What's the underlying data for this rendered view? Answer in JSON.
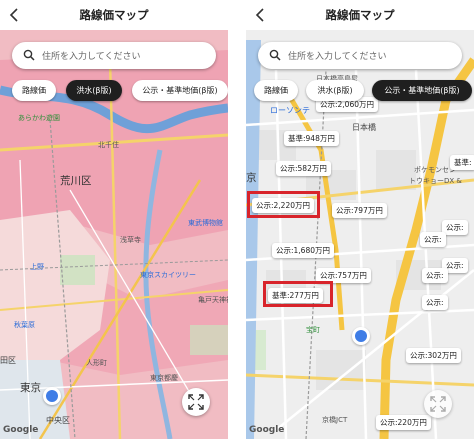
{
  "left": {
    "title": "路線価マップ",
    "search_placeholder": "住所を入力してください",
    "chips": [
      "路線価",
      "洪水(β版)",
      "公示・基準地価(β版)"
    ],
    "active_chip": "洪水(β版)",
    "labels": [
      "あらかわ遊園",
      "北千住",
      "荒川区",
      "東武博物館",
      "浅草寺",
      "上野",
      "東京スカイツリー",
      "亀戸天神社",
      "秋葉原",
      "人形町",
      "東京都慶",
      "東京",
      "中央区",
      "田区"
    ],
    "attribution": "Google"
  },
  "right": {
    "title": "路線価マップ",
    "search_placeholder": "住所を入力してください",
    "chips": [
      "路線価",
      "洪水(β版)",
      "公示・基準地価(β版)"
    ],
    "active_chip": "公示・基準地価(β版)",
    "price_tags": [
      "公示:2,060万円",
      "基準:948万円",
      "公示:582万円",
      "公示:2,220万円",
      "公示:797万円",
      "公示:1,680万円",
      "公示:757万円",
      "基準:277万円",
      "公示:302万円",
      "公示:220万円",
      "基準:",
      "公示:",
      "公示:",
      "公示:",
      "公示:",
      "公示:"
    ],
    "highlighted": [
      "公示:2,220万円",
      "基準:277万円"
    ],
    "labels": [
      "日本橋高島屋",
      "ローソンテ",
      "日本橋",
      "ポケモンセン",
      "トウキョーDX &",
      "宝町",
      "京橋JCT",
      "京"
    ],
    "attribution": "Google"
  }
}
